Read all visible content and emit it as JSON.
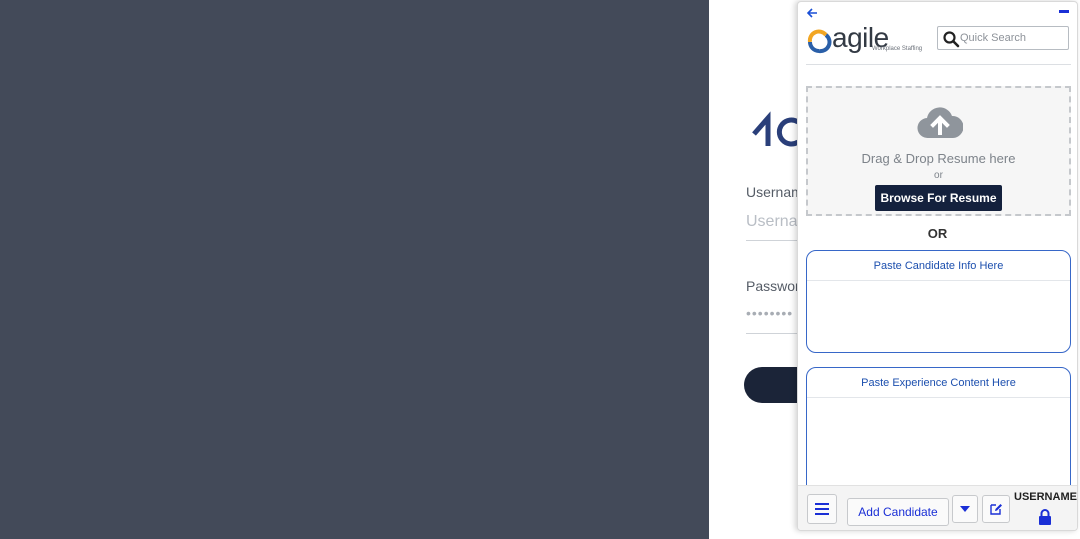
{
  "background_page": {
    "username_label": "Usernam",
    "username_placeholder": "Userna",
    "password_label": "Password",
    "password_value": "••••••••"
  },
  "panel": {
    "brand": {
      "word": "agile",
      "tagline": "Workplace Staffing"
    },
    "search": {
      "placeholder": "Quick Search"
    },
    "dropzone": {
      "text": "Drag & Drop Resume here",
      "or": "or",
      "browse_label": "Browse For Resume"
    },
    "or_divider": "OR",
    "candidate_info": {
      "header": "Paste Candidate Info Here"
    },
    "experience": {
      "header": "Paste Experience Content Here"
    },
    "footer": {
      "add_candidate_label": "Add Candidate",
      "username": "USERNAME"
    }
  },
  "colors": {
    "dark_pane": "#434a59",
    "accent_blue": "#1a2fd6",
    "browse_button": "#14213d",
    "paste_border": "#3767c8"
  },
  "icons": [
    "back-arrow-icon",
    "minimize-icon",
    "search-icon",
    "cloud-upload-icon",
    "menu-icon",
    "caret-down-icon",
    "edit-icon",
    "lock-icon"
  ]
}
